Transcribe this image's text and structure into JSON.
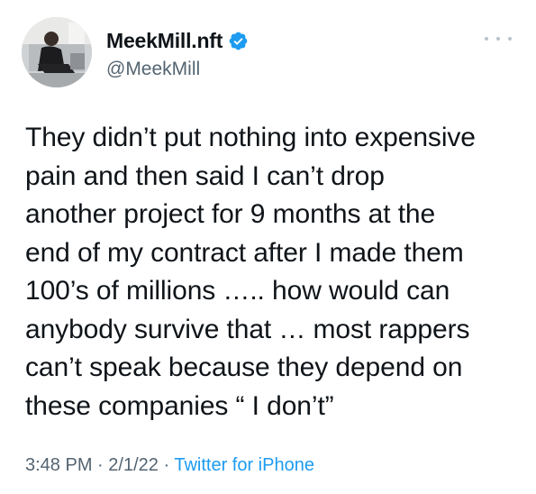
{
  "tweet": {
    "author": {
      "display_name": "MeekMill.nft",
      "handle": "@MeekMill",
      "verified": true
    },
    "text": "They didn’t put nothing into expensive\npain and then said I can’t drop\nanother project for 9 months at the\nend of my contract after I made them\n100’s of millions ….. how would can\nanybody survive that … most rappers\ncan’t speak because they depend on\nthese companies “ I don’t”",
    "time": "3:48 PM",
    "separator": "·",
    "date": "2/1/22",
    "source": "Twitter for iPhone",
    "icons": {
      "verified": "verified-badge-icon",
      "more": "more-options-icon"
    }
  },
  "colors": {
    "text": "#0f1419",
    "secondary": "#536471",
    "accent": "#1d9bf0"
  }
}
